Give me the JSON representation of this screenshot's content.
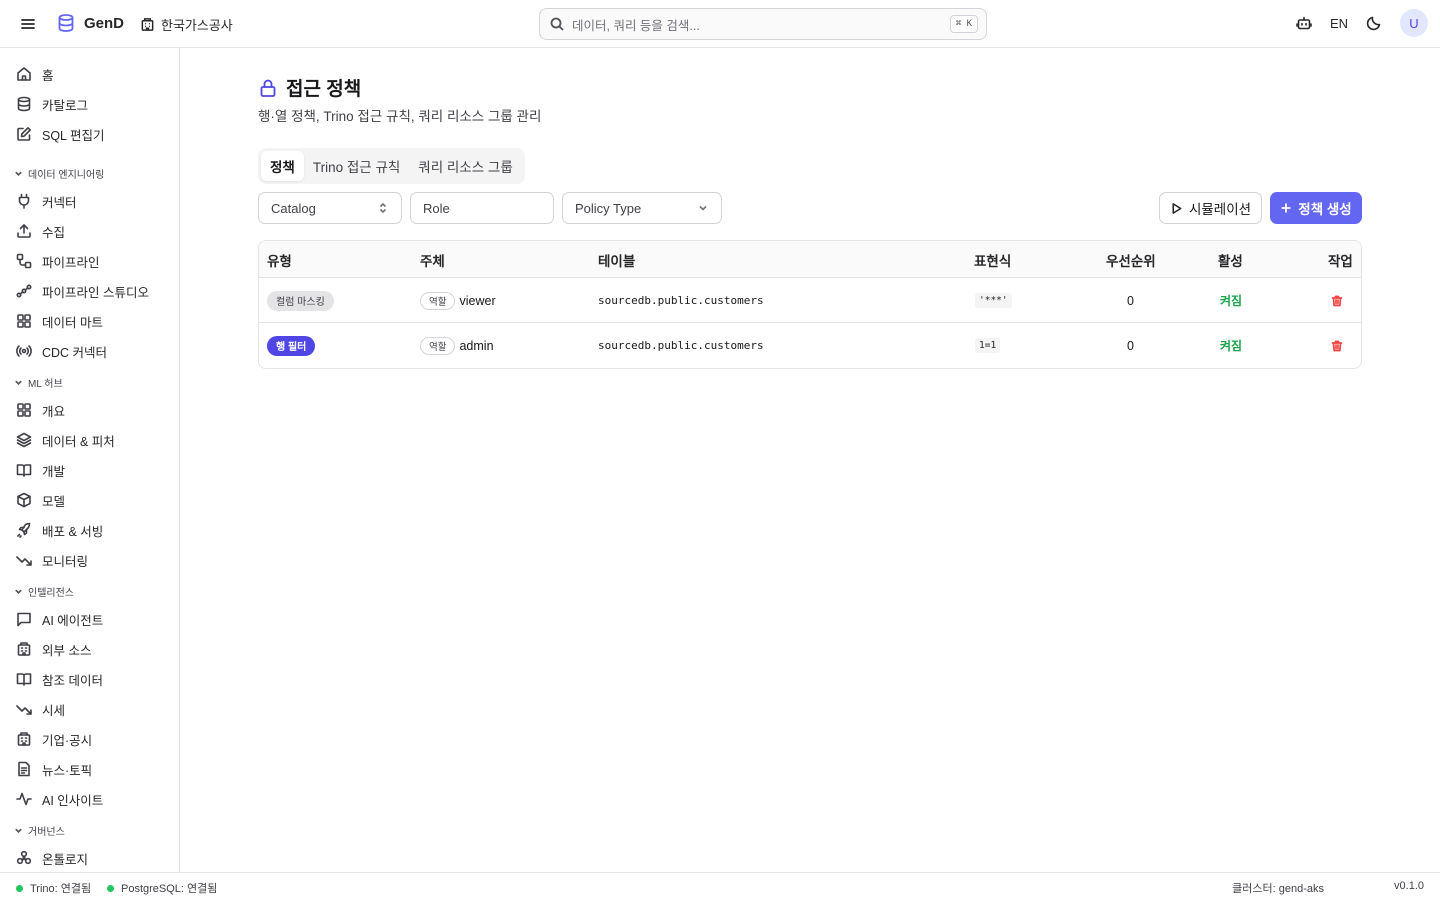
{
  "header": {
    "brand": "GenD",
    "org": "한국가스공사",
    "search_placeholder": "데이터, 쿼리 등을 검색...",
    "search_shortcut": "⌘ K",
    "lang": "EN",
    "avatar": "U"
  },
  "sidebar": {
    "top_items": [
      {
        "label": "홈",
        "icon": "home-icon"
      },
      {
        "label": "카탈로그",
        "icon": "database-icon"
      },
      {
        "label": "SQL 편집기",
        "icon": "edit-icon"
      }
    ],
    "sections": [
      {
        "title": "데이터 엔지니어링",
        "items": [
          {
            "label": "커넥터",
            "icon": "plug-icon"
          },
          {
            "label": "수집",
            "icon": "upload-icon"
          },
          {
            "label": "파이프라인",
            "icon": "route-icon"
          },
          {
            "label": "파이프라인 스튜디오",
            "icon": "workflow-icon"
          },
          {
            "label": "데이터 마트",
            "icon": "grid-icon"
          },
          {
            "label": "CDC 커넥터",
            "icon": "radio-icon"
          }
        ]
      },
      {
        "title": "ML 허브",
        "items": [
          {
            "label": "개요",
            "icon": "grid-icon"
          },
          {
            "label": "데이터 & 피처",
            "icon": "layers-icon"
          },
          {
            "label": "개발",
            "icon": "book-icon"
          },
          {
            "label": "모델",
            "icon": "box-icon"
          },
          {
            "label": "배포 & 서빙",
            "icon": "rocket-icon"
          },
          {
            "label": "모니터링",
            "icon": "trend-down-icon"
          }
        ]
      },
      {
        "title": "인텔리전스",
        "items": [
          {
            "label": "AI 에이전트",
            "icon": "message-icon"
          },
          {
            "label": "외부 소스",
            "icon": "building-icon"
          },
          {
            "label": "참조 데이터",
            "icon": "book-icon"
          },
          {
            "label": "시세",
            "icon": "trend-down-icon"
          },
          {
            "label": "기업·공시",
            "icon": "building-icon"
          },
          {
            "label": "뉴스·토픽",
            "icon": "file-text-icon"
          },
          {
            "label": "AI 인사이트",
            "icon": "activity-icon"
          }
        ]
      },
      {
        "title": "거버넌스",
        "items": [
          {
            "label": "온톨로지",
            "icon": "network-icon"
          }
        ]
      }
    ]
  },
  "page": {
    "title": "접근 정책",
    "subtitle": "행·열 정책, Trino 접근 규칙, 쿼리 리소스 그룹 관리",
    "tabs": [
      {
        "label": "정책",
        "active": true
      },
      {
        "label": "Trino 접근 규칙",
        "active": false
      },
      {
        "label": "쿼리 리소스 그룹",
        "active": false
      }
    ],
    "filters": {
      "catalog": "Catalog",
      "role": "Role",
      "policy_type": "Policy Type"
    },
    "buttons": {
      "simulate": "시뮬레이션",
      "create": "정책 생성"
    }
  },
  "table": {
    "columns": [
      "유형",
      "주체",
      "테이블",
      "표현식",
      "우선순위",
      "활성",
      "작업"
    ],
    "rows": [
      {
        "type": "컬럼 마스킹",
        "type_style": "gray",
        "subject_tag": "역할",
        "subject": "viewer",
        "table": "sourcedb.public.customers",
        "expression": "'***'",
        "priority": "0",
        "active": "켜짐"
      },
      {
        "type": "행 필터",
        "type_style": "indigo",
        "subject_tag": "역할",
        "subject": "admin",
        "table": "sourcedb.public.customers",
        "expression": "1=1",
        "priority": "0",
        "active": "켜짐"
      }
    ]
  },
  "statusbar": {
    "trino": "Trino: 연결됨",
    "postgres": "PostgreSQL: 연결됨",
    "cluster": "클러스터: gend-aks",
    "version": "v0.1.0"
  },
  "colors": {
    "accent": "#6366f1",
    "active_green": "#16a34a",
    "status_dot": "#22c55e",
    "delete_red": "#ef4444"
  }
}
